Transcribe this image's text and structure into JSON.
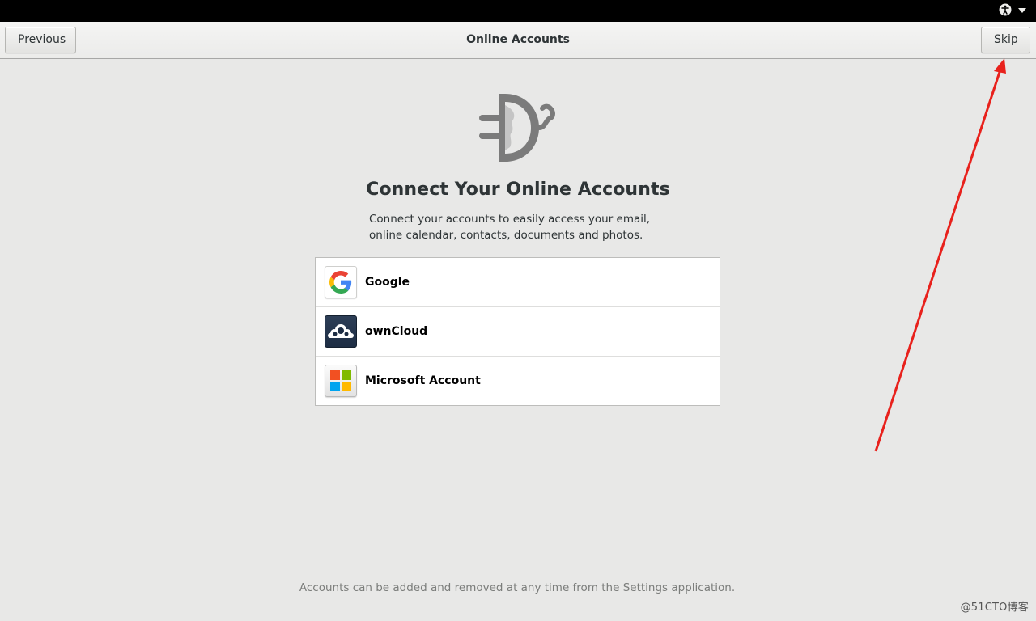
{
  "topbar": {
    "accessibility_icon": "accessibility-icon",
    "menu_icon": "caret-down-icon"
  },
  "headerbar": {
    "title": "Online Accounts",
    "previous_label": "Previous",
    "skip_label": "Skip"
  },
  "main": {
    "hero_icon": "online-accounts-icon",
    "heading": "Connect Your Online Accounts",
    "description_line1": "Connect your accounts to easily access your email,",
    "description_line2": "online calendar, contacts, documents and photos.",
    "providers": [
      {
        "label": "Google",
        "icon": "google-icon"
      },
      {
        "label": "ownCloud",
        "icon": "owncloud-icon"
      },
      {
        "label": "Microsoft Account",
        "icon": "microsoft-icon"
      }
    ],
    "footer_note": "Accounts can be added and removed at any time from the Settings application."
  },
  "overlay": {
    "watermark": "@51CTO博客",
    "arrow_color": "#e8211c"
  },
  "colors": {
    "background": "#e8e8e7",
    "topbar": "#000000",
    "text": "#2e3436",
    "footer_text": "#7b7d7b"
  }
}
